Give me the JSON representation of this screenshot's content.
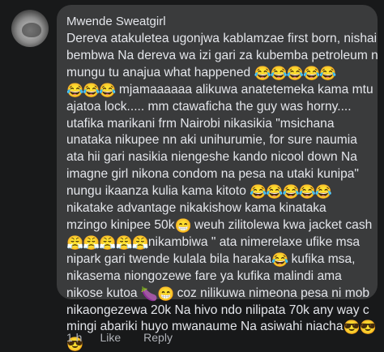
{
  "comment": {
    "author": "Mwende Sweatgirl",
    "lines": [
      {
        "text": "Dereva atakuletea ugonjwa kablamzae first born, nishai",
        "emoji": ""
      },
      {
        "text": "bembwa Na dereva wa izi gari za kubemba petroleum n",
        "emoji": ""
      },
      {
        "text": "mungu  tu anajua  what happened ",
        "emoji": "😂😂😂😂😂"
      },
      {
        "text": "",
        "emoji": "😂😂😂",
        "after": " mjamaaaaaa alikuwa anatetemeka  kama mtu"
      },
      {
        "text": "ajatoa lock.....  mm ctawaficha the guy was horny....",
        "emoji": ""
      },
      {
        "text": "utafika marikani frm Nairobi  nikasikia  \"msichana",
        "emoji": ""
      },
      {
        "text": "unataka  nikupee  nn aki unihurumie, for sure naumia",
        "emoji": ""
      },
      {
        "text": "ata hii gari nasikia niengeshe kando nicool  down Na",
        "emoji": ""
      },
      {
        "text": "imagne girl nikona condom na pesa na utaki kunipa\"",
        "emoji": ""
      },
      {
        "text": "nungu  ikaanza  kulia kama kitoto ",
        "emoji": "😂😂😂😂😂"
      },
      {
        "text": "nikatake  advantage  nikakishow kama  kinataka",
        "emoji": ""
      },
      {
        "text": "mzingo kinipee 50k",
        "emoji": "😁",
        "after": " weuh zilitolewa kwa jacket cash"
      },
      {
        "text": "",
        "emoji": "😤😤😤😤😤",
        "after": "nikambiwa  \" ata nimerelaxe ufike msa"
      },
      {
        "text": "nipark gari  twende kulala bila haraka",
        "emoji": "😂",
        "after": "  kufika msa,"
      },
      {
        "text": "nikasema  niongozewe fare ya kufika malindi ama",
        "emoji": ""
      },
      {
        "text": "nikose  kutoa ",
        "emoji": "🍆😁",
        "after": " coz nilikuwa nimeona pesa ni mob"
      },
      {
        "text": "nikaongezewa 20k Na hivo  ndo nilipata  70k any way c",
        "emoji": ""
      },
      {
        "text": "mingi abariki  huyo mwanaume Na asiwahi niacha",
        "emoji": "😎😎"
      },
      {
        "text": "",
        "emoji": "😎"
      }
    ]
  },
  "actions": {
    "time": "1 h",
    "like": "Like",
    "reply": "Reply"
  },
  "colors": {
    "background": "#18191a",
    "bubble": "#3a3b3c",
    "text": "#e4e6eb",
    "muted": "#b0b3b8"
  }
}
